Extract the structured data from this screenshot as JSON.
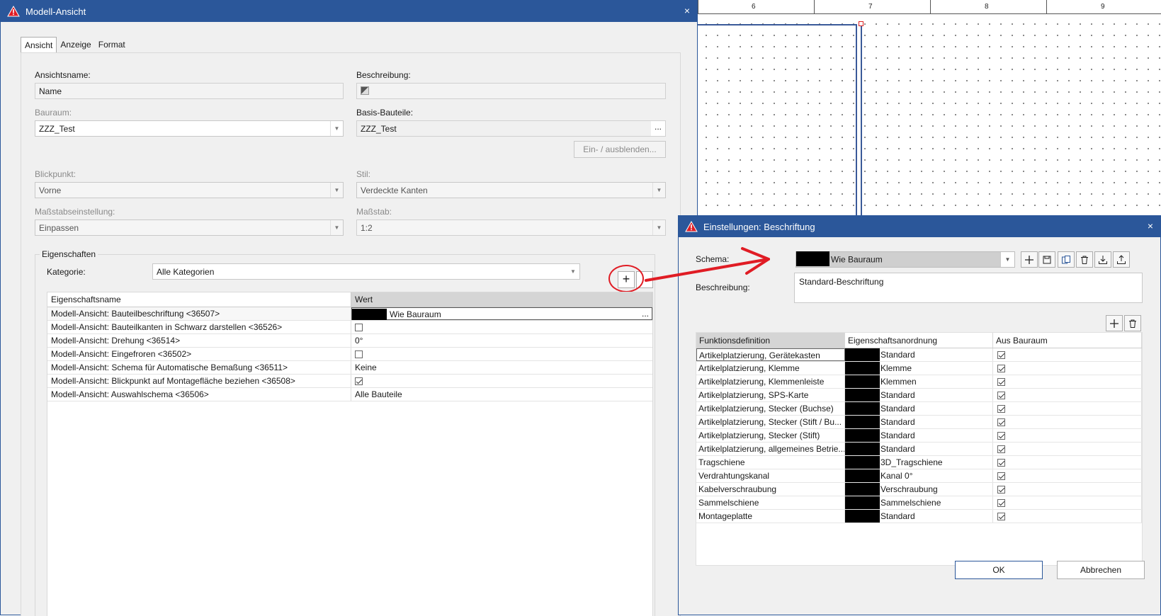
{
  "canvas": {
    "ruler_numbers": [
      "6",
      "7",
      "8",
      "9"
    ]
  },
  "main_dialog": {
    "title": "Modell-Ansicht",
    "close": "×",
    "tabs": [
      {
        "label": "Ansicht",
        "active": true
      },
      {
        "label": "Anzeige",
        "active": false
      },
      {
        "label": "Format",
        "active": false
      }
    ],
    "ansichtsname": {
      "label": "Ansichtsname:",
      "value": "Name"
    },
    "beschreibung": {
      "label": "Beschreibung:"
    },
    "bauraum": {
      "label": "Bauraum:",
      "value": "ZZZ_Test"
    },
    "basis_bauteile": {
      "label": "Basis-Bauteile:",
      "value": "ZZZ_Test",
      "button": "..."
    },
    "toggle_button": "Ein- / ausblenden...",
    "blickpunkt": {
      "label": "Blickpunkt:",
      "value": "Vorne"
    },
    "stil": {
      "label": "Stil:",
      "value": "Verdeckte Kanten"
    },
    "massstabseinstellung": {
      "label": "Maßstabseinstellung:",
      "value": "Einpassen"
    },
    "massstab": {
      "label": "Maßstab:",
      "value": "1:2"
    },
    "eigenschaften": {
      "title": "Eigenschaften",
      "kategorie_label": "Kategorie:",
      "kategorie_value": "Alle Kategorien",
      "add_button": "+",
      "columns": [
        "Eigenschaftsname",
        "Wert"
      ],
      "rows": [
        {
          "name": "Modell-Ansicht: Bauteilbeschriftung <36507>",
          "value": "Wie Bauraum",
          "type": "text-redacted",
          "button": "..."
        },
        {
          "name": "Modell-Ansicht: Bauteilkanten in Schwarz darstellen <36526>",
          "value": "",
          "type": "checkbox",
          "checked": false
        },
        {
          "name": "Modell-Ansicht: Drehung <36514>",
          "value": "0°",
          "type": "text"
        },
        {
          "name": "Modell-Ansicht: Eingefroren <36502>",
          "value": "",
          "type": "checkbox",
          "checked": false
        },
        {
          "name": "Modell-Ansicht: Schema für Automatische Bemaßung <36511>",
          "value": "Keine",
          "type": "text"
        },
        {
          "name": "Modell-Ansicht: Blickpunkt auf Montagefläche beziehen <36508>",
          "value": "",
          "type": "checkbox",
          "checked": true
        },
        {
          "name": "Modell-Ansicht: Auswahlschema <36506>",
          "value": "Alle Bauteile",
          "type": "text"
        }
      ]
    }
  },
  "settings_dialog": {
    "title": "Einstellungen: Beschriftung",
    "close": "×",
    "schema_label": "Schema:",
    "schema_value": "Wie Bauraum",
    "beschreibung_label": "Beschreibung:",
    "beschreibung_value": "Standard-Beschriftung",
    "toolbar_icons": [
      "plus-icon",
      "save-icon",
      "copy-icon",
      "delete-icon",
      "import-icon",
      "export-icon"
    ],
    "columns": [
      "Funktionsdefinition",
      "Eigenschaftsanordnung",
      "Aus Bauraum"
    ],
    "rows": [
      {
        "func": "Artikelplatzierung, Gerätekasten",
        "anordnung": "Standard",
        "checked": true
      },
      {
        "func": "Artikelplatzierung, Klemme",
        "anordnung": "Klemme",
        "checked": true
      },
      {
        "func": "Artikelplatzierung, Klemmenleiste",
        "anordnung": "Klemmen",
        "checked": true
      },
      {
        "func": "Artikelplatzierung, SPS-Karte",
        "anordnung": "Standard",
        "checked": true
      },
      {
        "func": "Artikelplatzierung, Stecker (Buchse)",
        "anordnung": "Standard",
        "checked": true
      },
      {
        "func": "Artikelplatzierung, Stecker (Stift / Bu...",
        "anordnung": "Standard",
        "checked": true
      },
      {
        "func": "Artikelplatzierung, Stecker (Stift)",
        "anordnung": "Standard",
        "checked": true
      },
      {
        "func": "Artikelplatzierung, allgemeines Betrie...",
        "anordnung": "Standard",
        "checked": true
      },
      {
        "func": "Tragschiene",
        "anordnung": "3D_Tragschiene",
        "checked": true
      },
      {
        "func": "Verdrahtungskanal",
        "anordnung": "Kanal 0°",
        "checked": true
      },
      {
        "func": "Kabelverschraubung",
        "anordnung": "Verschraubung",
        "checked": true
      },
      {
        "func": "Sammelschiene",
        "anordnung": "Sammelschiene",
        "checked": true
      },
      {
        "func": "Montageplatte",
        "anordnung": "Standard",
        "checked": true
      }
    ],
    "ok": "OK",
    "cancel": "Abbrechen"
  },
  "colors": {
    "titlebar": "#2b579a",
    "annotation_red": "#e01c24"
  }
}
